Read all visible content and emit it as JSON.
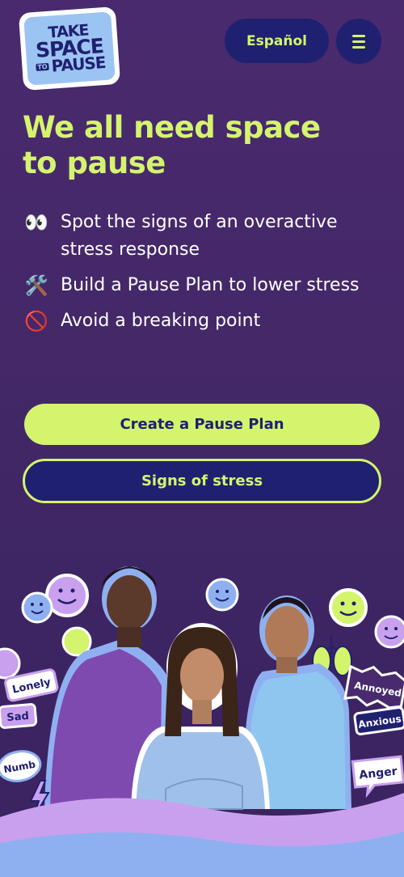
{
  "header": {
    "logo": {
      "line1": "TAKE",
      "line2": "SPACE",
      "line3a": "TO",
      "line3b": "PAUSE"
    },
    "language_label": "Español",
    "menu_icon": "hamburger-icon"
  },
  "hero": {
    "title": "We all need space to pause",
    "features": [
      {
        "emoji": "👀",
        "text": "Spot the signs of an overactive stress response"
      },
      {
        "emoji": "🛠️",
        "text": "Build a Pause Plan to lower stress"
      },
      {
        "emoji": "🚫",
        "text": "Avoid a breaking point"
      }
    ]
  },
  "actions": {
    "primary_label": "Create a Pause Plan",
    "secondary_label": "Signs of stress"
  },
  "stickers": {
    "lonely": "Lonely",
    "sad": "Sad",
    "numb": "Numb",
    "annoyed": "Annoyed",
    "anxious": "Anxious",
    "anger": "Anger"
  },
  "colors": {
    "accent": "#d4f46e",
    "navy": "#1f2070",
    "background": "#442868",
    "lavender": "#c9a0ee",
    "sky": "#8fb0f0"
  }
}
